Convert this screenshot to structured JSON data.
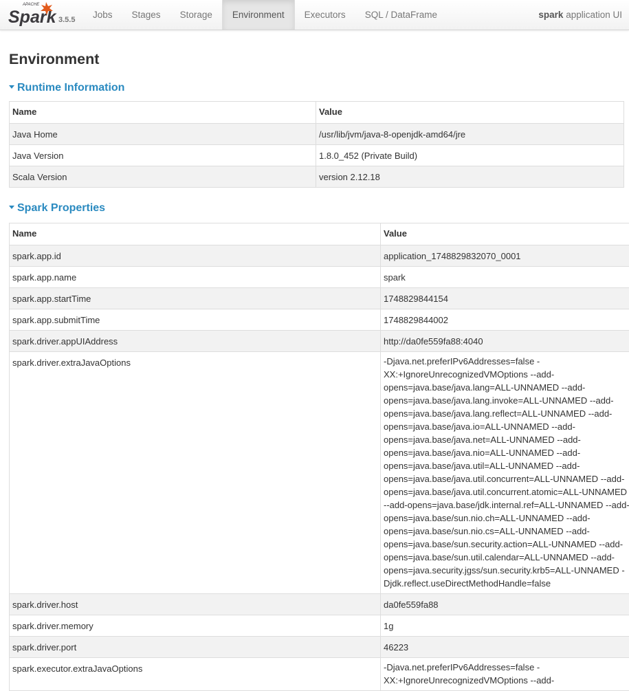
{
  "navbar": {
    "logo_text": "Spark",
    "logo_tagline": "APACHE",
    "version": "3.5.5",
    "tabs": [
      {
        "label": "Jobs",
        "active": false
      },
      {
        "label": "Stages",
        "active": false
      },
      {
        "label": "Storage",
        "active": false
      },
      {
        "label": "Environment",
        "active": true
      },
      {
        "label": "Executors",
        "active": false
      },
      {
        "label": "SQL / DataFrame",
        "active": false
      }
    ],
    "app_name": "spark",
    "app_suffix": " application UI"
  },
  "page": {
    "title": "Environment"
  },
  "runtime": {
    "header": "Runtime Information",
    "columns": [
      "Name",
      "Value"
    ],
    "rows": [
      {
        "name": "Java Home",
        "value": "/usr/lib/jvm/java-8-openjdk-amd64/jre"
      },
      {
        "name": "Java Version",
        "value": "1.8.0_452 (Private Build)"
      },
      {
        "name": "Scala Version",
        "value": "version 2.12.18"
      }
    ]
  },
  "spark_props": {
    "header": "Spark Properties",
    "columns": [
      "Name",
      "Value"
    ],
    "rows": [
      {
        "name": "spark.app.id",
        "value": "application_1748829832070_0001"
      },
      {
        "name": "spark.app.name",
        "value": "spark"
      },
      {
        "name": "spark.app.startTime",
        "value": "1748829844154"
      },
      {
        "name": "spark.app.submitTime",
        "value": "1748829844002"
      },
      {
        "name": "spark.driver.appUIAddress",
        "value": "http://da0fe559fa88:4040"
      },
      {
        "name": "spark.driver.extraJavaOptions",
        "value": "-Djava.net.preferIPv6Addresses=false -XX:+IgnoreUnrecognizedVMOptions --add-opens=java.base/java.lang=ALL-UNNAMED --add-opens=java.base/java.lang.invoke=ALL-UNNAMED --add-opens=java.base/java.lang.reflect=ALL-UNNAMED --add-opens=java.base/java.io=ALL-UNNAMED --add-opens=java.base/java.net=ALL-UNNAMED --add-opens=java.base/java.nio=ALL-UNNAMED --add-opens=java.base/java.util=ALL-UNNAMED --add-opens=java.base/java.util.concurrent=ALL-UNNAMED --add-opens=java.base/java.util.concurrent.atomic=ALL-UNNAMED --add-opens=java.base/jdk.internal.ref=ALL-UNNAMED --add-opens=java.base/sun.nio.ch=ALL-UNNAMED --add-opens=java.base/sun.nio.cs=ALL-UNNAMED --add-opens=java.base/sun.security.action=ALL-UNNAMED --add-opens=java.base/sun.util.calendar=ALL-UNNAMED --add-opens=java.security.jgss/sun.security.krb5=ALL-UNNAMED -Djdk.reflect.useDirectMethodHandle=false"
      },
      {
        "name": "spark.driver.host",
        "value": "da0fe559fa88"
      },
      {
        "name": "spark.driver.memory",
        "value": "1g"
      },
      {
        "name": "spark.driver.port",
        "value": "46223"
      },
      {
        "name": "spark.executor.extraJavaOptions",
        "value": "-Djava.net.preferIPv6Addresses=false -XX:+IgnoreUnrecognizedVMOptions --add-"
      }
    ]
  },
  "colors": {
    "section_header": "#2a8ac0",
    "logo_orange": "#e25a1c",
    "logo_text": "#3c3a3e",
    "striped_row": "#f2f2f2"
  }
}
